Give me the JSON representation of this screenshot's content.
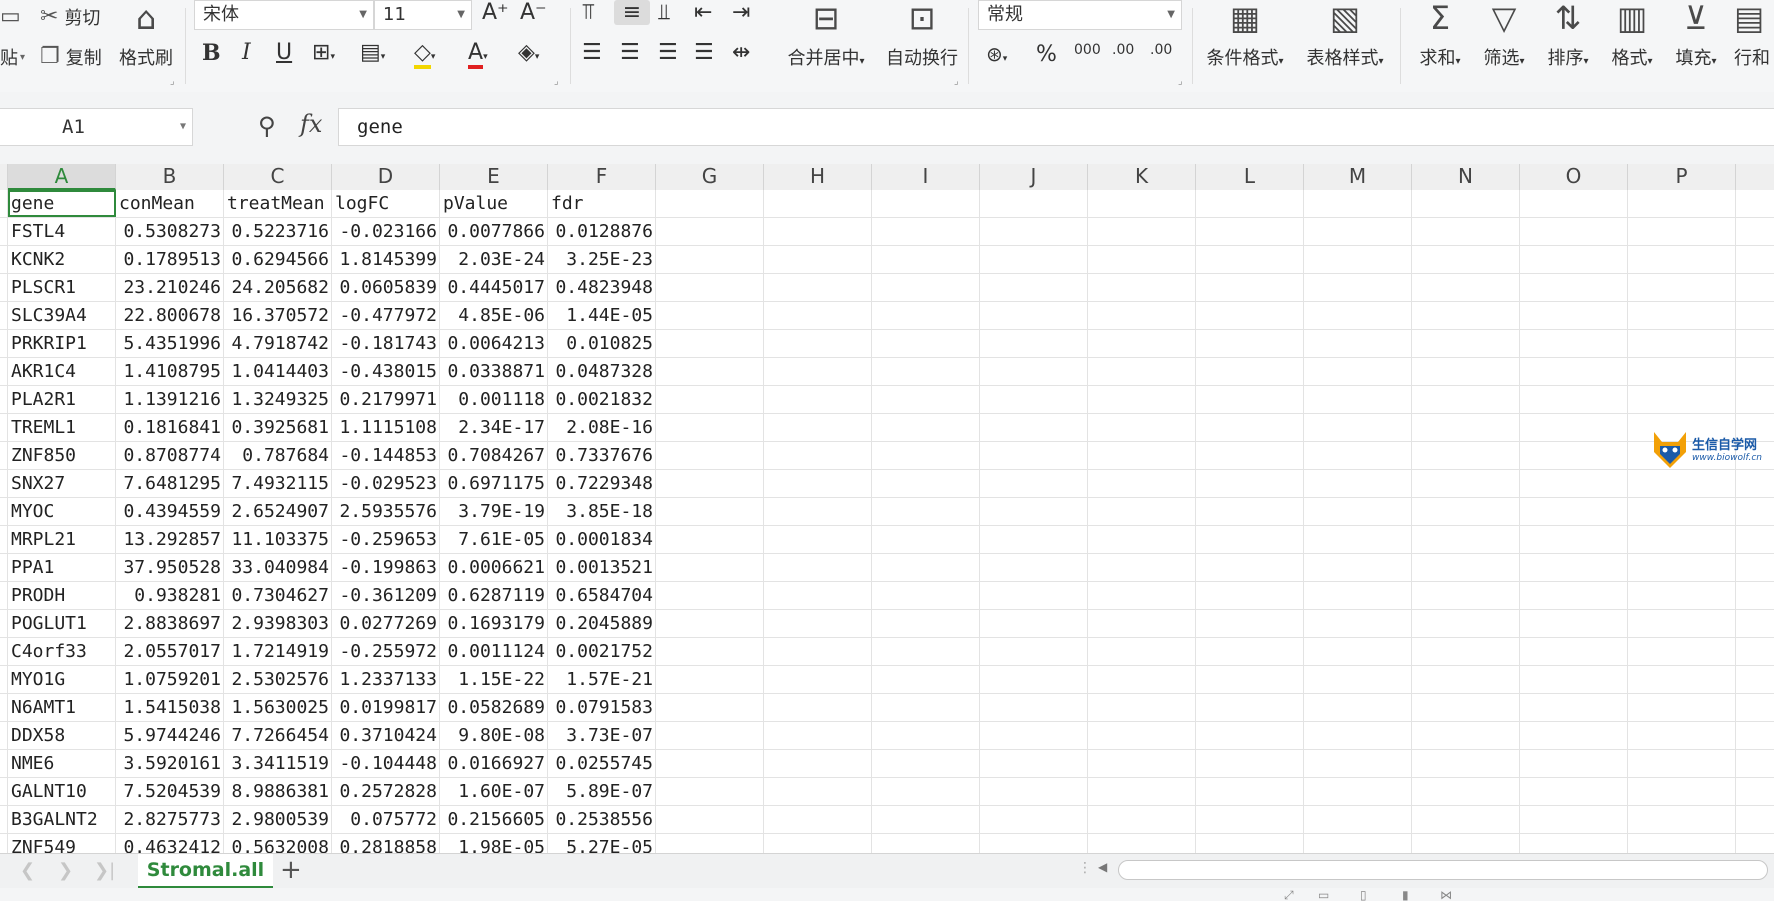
{
  "ribbon": {
    "clipboard": {
      "paste": "贴",
      "cut": "剪切",
      "copy": "复制",
      "format_painter": "格式刷"
    },
    "font": {
      "name": "宋体",
      "size": "11",
      "bold": "B",
      "italic": "I",
      "underline": "U",
      "font_color_glyph": "A"
    },
    "alignment": {
      "merge_center": "合并居中",
      "wrap_text": "自动换行"
    },
    "number": {
      "format": "常规",
      "percent": "%",
      "thousands": "000",
      "inc_decimal": ".00",
      "dec_decimal": ".00"
    },
    "styles": {
      "conditional_format": "条件格式",
      "table_style": "表格样式"
    },
    "editing": {
      "sum": "求和",
      "filter": "筛选",
      "sort": "排序",
      "format": "格式",
      "fill": "填充",
      "row_col": "行和"
    }
  },
  "formula_bar": {
    "name_box": "A1",
    "fx": "fx",
    "content": "gene"
  },
  "columns": [
    "A",
    "B",
    "C",
    "D",
    "E",
    "F",
    "G",
    "H",
    "I",
    "J",
    "K",
    "L",
    "M",
    "N",
    "O",
    "P"
  ],
  "selected_column": "A",
  "rows": [
    [
      "gene",
      "conMean",
      "treatMean",
      "logFC",
      "pValue",
      "fdr"
    ],
    [
      "FSTL4",
      "0.5308273",
      "0.5223716",
      "-0.023166",
      "0.0077866",
      "0.0128876"
    ],
    [
      "KCNK2",
      "0.1789513",
      "0.6294566",
      "1.8145399",
      "2.03E-24",
      "3.25E-23"
    ],
    [
      "PLSCR1",
      "23.210246",
      "24.205682",
      "0.0605839",
      "0.4445017",
      "0.4823948"
    ],
    [
      "SLC39A4",
      "22.800678",
      "16.370572",
      "-0.477972",
      "4.85E-06",
      "1.44E-05"
    ],
    [
      "PRKRIP1",
      "5.4351996",
      "4.7918742",
      "-0.181743",
      "0.0064213",
      "0.010825"
    ],
    [
      "AKR1C4",
      "1.4108795",
      "1.0414403",
      "-0.438015",
      "0.0338871",
      "0.0487328"
    ],
    [
      "PLA2R1",
      "1.1391216",
      "1.3249325",
      "0.2179971",
      "0.001118",
      "0.0021832"
    ],
    [
      "TREML1",
      "0.1816841",
      "0.3925681",
      "1.1115108",
      "2.34E-17",
      "2.08E-16"
    ],
    [
      "ZNF850",
      "0.8708774",
      "0.787684",
      "-0.144853",
      "0.7084267",
      "0.7337676"
    ],
    [
      "SNX27",
      "7.6481295",
      "7.4932115",
      "-0.029523",
      "0.6971175",
      "0.7229348"
    ],
    [
      "MYOC",
      "0.4394559",
      "2.6524907",
      "2.5935576",
      "3.79E-19",
      "3.85E-18"
    ],
    [
      "MRPL21",
      "13.292857",
      "11.103375",
      "-0.259653",
      "7.61E-05",
      "0.0001834"
    ],
    [
      "PPA1",
      "37.950528",
      "33.040984",
      "-0.199863",
      "0.0006621",
      "0.0013521"
    ],
    [
      "PRODH",
      "0.938281",
      "0.7304627",
      "-0.361209",
      "0.6287119",
      "0.6584704"
    ],
    [
      "POGLUT1",
      "2.8838697",
      "2.9398303",
      "0.0277269",
      "0.1693179",
      "0.2045889"
    ],
    [
      "C4orf33",
      "2.0557017",
      "1.7214919",
      "-0.255972",
      "0.0011124",
      "0.0021752"
    ],
    [
      "MYO1G",
      "1.0759201",
      "2.5302576",
      "1.2337133",
      "1.15E-22",
      "1.57E-21"
    ],
    [
      "N6AMT1",
      "1.5415038",
      "1.5630025",
      "0.0199817",
      "0.0582689",
      "0.0791583"
    ],
    [
      "DDX58",
      "5.9744246",
      "7.7266454",
      "0.3710424",
      "9.80E-08",
      "3.73E-07"
    ],
    [
      "NME6",
      "3.5920161",
      "3.3411519",
      "-0.104448",
      "0.0166927",
      "0.0255745"
    ],
    [
      "GALNT10",
      "7.5204539",
      "8.9886381",
      "0.2572828",
      "1.60E-07",
      "5.89E-07"
    ],
    [
      "B3GALNT2",
      "2.8275773",
      "2.9800539",
      "0.075772",
      "0.2156605",
      "0.2538556"
    ],
    [
      "ZNF549",
      "0.4632412",
      "0.5632008",
      "0.2818858",
      "1.98E-05",
      "5.27E-05"
    ]
  ],
  "sheet_tabs": {
    "active": "Stromal.all",
    "add": "+"
  },
  "watermark": {
    "text": "生信自学网",
    "url": "www.biowolf.cn"
  },
  "colors": {
    "accent": "#2f8a3c",
    "grid_line": "#e3e3e3",
    "header_bg": "#efefef"
  }
}
